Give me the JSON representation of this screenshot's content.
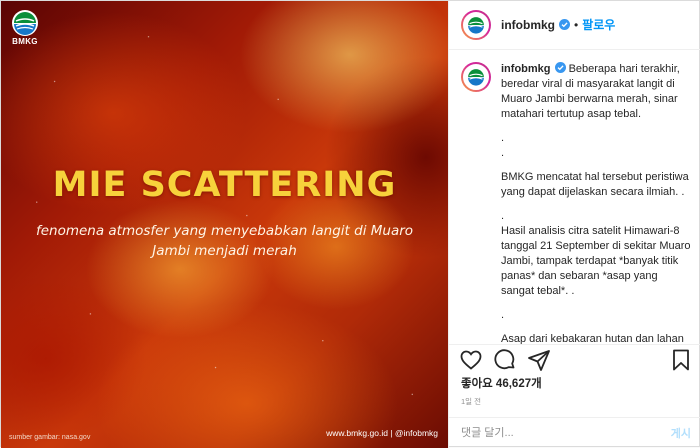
{
  "media": {
    "logo_text": "BMKG",
    "headline": "MIE SCATTERING",
    "subline": "fenomena atmosfer yang menyebabkan langit di Muaro Jambi menjadi merah",
    "credit_left": "sumber gambar: nasa.gov",
    "credit_right": "www.bmkg.go.id | @infobmkg",
    "icons": [
      "bmkg-logo"
    ]
  },
  "header": {
    "username": "infobmkg",
    "verified_icon": "verified-badge-icon",
    "separator": "•",
    "follow_label": "팔로우"
  },
  "caption": {
    "username": "infobmkg",
    "first_line": "Beberapa hari terakhir, beredar viral di masyarakat langit di Muaro Jambi berwarna merah, sinar matahari tertutup asap tebal.",
    "dot1": ".",
    "dot2": ".",
    "p2": "BMKG mencatat hal tersebut peristiwa yang dapat dijelaskan secara ilmiah. .",
    "dot3": ".",
    "p3": "Hasil analisis citra satelit Himawari-8 tanggal 21 September di sekitar Muaro Jambi, tampak terdapat *banyak titik panas* dan sebaran *asap yang sangat tebal*. .",
    "dot4": ".",
    "p4": "Asap dari kebakaran hutan dan lahan ini berbeda dari daerah lain yang juga mengalami kebakaran, wilayah lain"
  },
  "actions": {
    "icons": [
      "heart-icon",
      "comment-icon",
      "share-icon",
      "bookmark-icon"
    ]
  },
  "likes": "좋아요 46,627개",
  "time": "1일 전",
  "comment": {
    "placeholder": "댓글 달기...",
    "post_label": "게시"
  },
  "colors": {
    "accent": "#0095f6",
    "headline": "#f7d23b",
    "post_disabled": "#b2dffc"
  }
}
